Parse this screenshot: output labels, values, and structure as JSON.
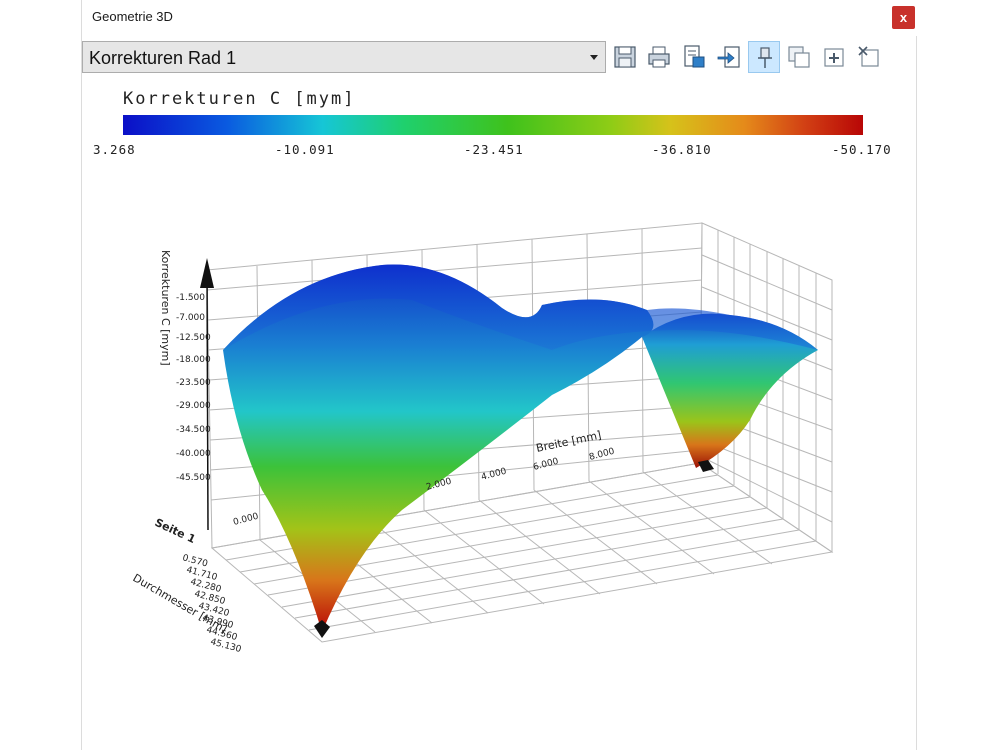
{
  "window": {
    "title": "Geometrie 3D",
    "close_label": "x"
  },
  "toolbar": {
    "selection": "Korrekturen Rad 1",
    "icons": [
      "save-icon",
      "print-icon",
      "print-preview-icon",
      "export-icon",
      "pin-icon",
      "copy-window-icon",
      "add-window-icon",
      "close-window-icon"
    ]
  },
  "legend": {
    "title": "Korrekturen C [mym]",
    "ticks": [
      "3.268",
      "-10.091",
      "-23.451",
      "-36.810",
      "-50.170"
    ],
    "colors": [
      "#0b0fc7",
      "#16c6d6",
      "#3fc21c",
      "#d6c21a",
      "#b80606"
    ]
  },
  "plot": {
    "z_axis_label": "Korrekturen C [mym]",
    "z_ticks": [
      "-1.500",
      "-7.000",
      "-12.500",
      "-18.000",
      "-23.500",
      "-29.000",
      "-34.500",
      "-40.000",
      "-45.500"
    ],
    "x_axis_label": "Breite [mm]",
    "x_ticks": [
      "0.000",
      "2.000",
      "4.000",
      "6.000",
      "8.000"
    ],
    "y_axis_label": "Durchmesser [mm]",
    "y_ticks": [
      "0.570",
      "41.710",
      "42.280",
      "42.850",
      "43.420",
      "43.990",
      "44.560",
      "45.130"
    ],
    "side_label": "Seite 1"
  }
}
